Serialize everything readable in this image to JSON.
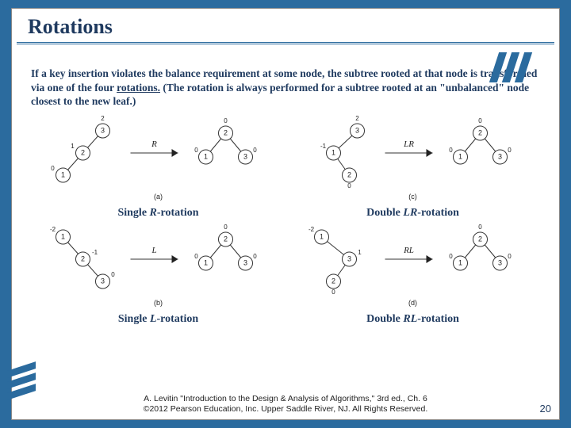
{
  "title": "Rotations",
  "intro_parts": {
    "p1": "If a key insertion violates the balance requirement at some node, the subtree rooted at that node is transformed via one of the four ",
    "rot": "rotations.",
    "p2": " (The rotation is always performed for a subtree rooted at an \"unbalanced\" node closest to the new leaf.)"
  },
  "captions": {
    "r": "Single ",
    "r_em": "R",
    "r_tail": "-rotation",
    "lr": "Double ",
    "lr_em": "LR",
    "lr_tail": "-rotation",
    "l": "Single ",
    "l_em": "L",
    "l_tail": "-rotation",
    "rl": "Double ",
    "rl_em": "RL",
    "rl_tail": "-rotation"
  },
  "ops": {
    "R": "R",
    "L": "L",
    "LR": "LR",
    "RL": "RL"
  },
  "sublabels": {
    "a": "(a)",
    "b": "(b)",
    "c": "(c)",
    "d": "(d)"
  },
  "footer": {
    "line1": "A. Levitin \"Introduction to the Design & Analysis of Algorithms,\" 3rd ed., Ch. 6",
    "line2": "©2012 Pearson Education, Inc. Upper Saddle River, NJ. All Rights Reserved."
  },
  "pagenum": "20",
  "chart_data": [
    {
      "type": "tree-rotation",
      "name": "R-rotation",
      "sublabel": "(a)",
      "before": {
        "nodes": [
          {
            "key": 3,
            "bf": 2
          },
          {
            "key": 2,
            "bf": 1
          },
          {
            "key": 1,
            "bf": 0
          }
        ],
        "edges": [
          [
            3,
            2,
            "L"
          ],
          [
            2,
            1,
            "L"
          ]
        ]
      },
      "after": {
        "nodes": [
          {
            "key": 2,
            "bf": 0
          },
          {
            "key": 1,
            "bf": 0
          },
          {
            "key": 3,
            "bf": 0
          }
        ],
        "edges": [
          [
            2,
            1,
            "L"
          ],
          [
            2,
            3,
            "R"
          ]
        ]
      }
    },
    {
      "type": "tree-rotation",
      "name": "LR-rotation",
      "sublabel": "(c)",
      "before": {
        "nodes": [
          {
            "key": 3,
            "bf": 2
          },
          {
            "key": 1,
            "bf": -1
          },
          {
            "key": 2,
            "bf": 0
          }
        ],
        "edges": [
          [
            3,
            1,
            "L"
          ],
          [
            1,
            2,
            "R"
          ]
        ]
      },
      "after": {
        "nodes": [
          {
            "key": 2,
            "bf": 0
          },
          {
            "key": 1,
            "bf": 0
          },
          {
            "key": 3,
            "bf": 0
          }
        ],
        "edges": [
          [
            2,
            1,
            "L"
          ],
          [
            2,
            3,
            "R"
          ]
        ]
      }
    },
    {
      "type": "tree-rotation",
      "name": "L-rotation",
      "sublabel": "(b)",
      "before": {
        "nodes": [
          {
            "key": 1,
            "bf": -2
          },
          {
            "key": 2,
            "bf": -1
          },
          {
            "key": 3,
            "bf": 0
          }
        ],
        "edges": [
          [
            1,
            2,
            "R"
          ],
          [
            2,
            3,
            "R"
          ]
        ]
      },
      "after": {
        "nodes": [
          {
            "key": 2,
            "bf": 0
          },
          {
            "key": 1,
            "bf": 0
          },
          {
            "key": 3,
            "bf": 0
          }
        ],
        "edges": [
          [
            2,
            1,
            "L"
          ],
          [
            2,
            3,
            "R"
          ]
        ]
      }
    },
    {
      "type": "tree-rotation",
      "name": "RL-rotation",
      "sublabel": "(d)",
      "before": {
        "nodes": [
          {
            "key": 1,
            "bf": -2
          },
          {
            "key": 3,
            "bf": 1
          },
          {
            "key": 2,
            "bf": 0
          }
        ],
        "edges": [
          [
            1,
            3,
            "R"
          ],
          [
            3,
            2,
            "L"
          ]
        ]
      },
      "after": {
        "nodes": [
          {
            "key": 2,
            "bf": 0
          },
          {
            "key": 1,
            "bf": 0
          },
          {
            "key": 3,
            "bf": 0
          }
        ],
        "edges": [
          [
            2,
            1,
            "L"
          ],
          [
            2,
            3,
            "R"
          ]
        ]
      }
    }
  ]
}
